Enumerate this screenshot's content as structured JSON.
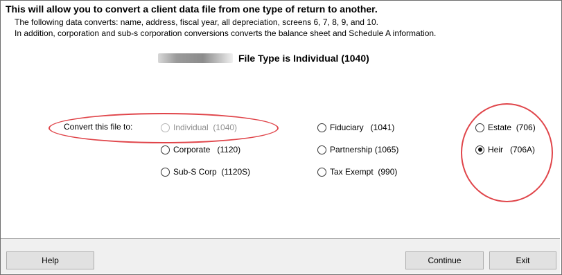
{
  "header": {
    "title": "This will allow you to convert a client data file from one type of return to another.",
    "line1": "The following data converts: name, address, fiscal year, all depreciation, screens 6, 7, 8, 9, and 10.",
    "line2": "In addition, corporation and sub-s corporation conversions converts the balance sheet and Schedule A information.",
    "file_type": "File Type is Individual (1040)"
  },
  "convert": {
    "label": "Convert this file to:",
    "options": [
      {
        "label": "Individual  (1040)",
        "disabled": true,
        "checked": false
      },
      {
        "label": "Corporate   (1120)",
        "disabled": false,
        "checked": false
      },
      {
        "label": "Sub-S Corp  (1120S)",
        "disabled": false,
        "checked": false
      },
      {
        "label": "Fiduciary   (1041)",
        "disabled": false,
        "checked": false
      },
      {
        "label": "Partnership (1065)",
        "disabled": false,
        "checked": false
      },
      {
        "label": "Tax Exempt  (990)",
        "disabled": false,
        "checked": false
      },
      {
        "label": "Estate  (706)",
        "disabled": false,
        "checked": false
      },
      {
        "label": "Heir   (706A)",
        "disabled": false,
        "checked": true
      }
    ]
  },
  "buttons": {
    "help": "Help",
    "continue": "Continue",
    "exit": "Exit"
  },
  "colors": {
    "annotation": "#e0454a",
    "button_bar": "#f0f0f0"
  }
}
